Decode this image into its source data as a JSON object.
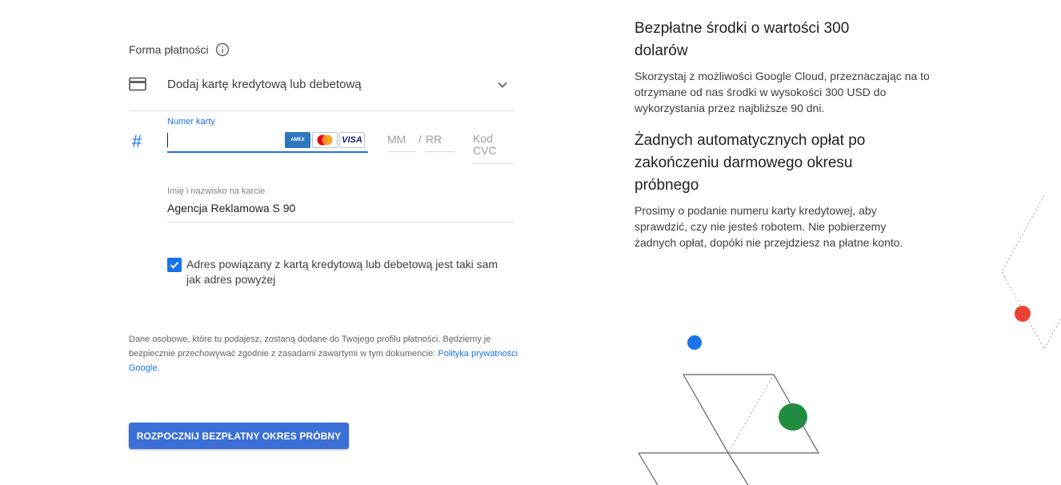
{
  "payment": {
    "section_title": "Forma płatności",
    "method_label": "Dodaj kartę kredytową lub debetową",
    "card_number_label": "Numer karty",
    "card_brands": [
      "AMEX",
      "MasterCard",
      "VISA"
    ],
    "month_placeholder": "MM",
    "year_separator": "/",
    "year_placeholder": "RR",
    "cvc_placeholder": "Kod CVC",
    "cardholder_label": "Imię i nazwisko na karcie",
    "cardholder_value": "Agencja Reklamowa S 90",
    "same_address_label": "Adres powiązany z kartą kredytową lub debetową jest taki sam jak adres powyżej",
    "same_address_checked": true,
    "privacy_text": "Dane osobowe, które tu podajesz, zostaną dodane do Twojego profilu płatności. Będziemy je bezpiecznie przechowywać zgodnie z zasadami zawartymi w tym dokumencie: ",
    "privacy_link": "Polityka prywatności Google",
    "privacy_end": ".",
    "start_button": "ROZPOCZNIJ BEZPŁATNY OKRES PRÓBNY"
  },
  "info": {
    "credits_title": "Bezpłatne środki o wartości 300 dolarów",
    "credits_text": "Skorzystaj z możliwości Google Cloud, przeznaczając na to otrzymane od nas środki w wysokości 300 USD do wykorzystania przez najbliższe 90 dni.",
    "no_charges_title": "Żadnych automatycznych opłat po zakończeniu darmowego okresu próbnego",
    "no_charges_text": "Prosimy o podanie numeru karty kredytowej, aby sprawdzić, czy nie jesteś robotem. Nie pobierzemy żadnych opłat, dopóki nie przejdziesz na płatne konto."
  },
  "colors": {
    "accent": "#1a73e8",
    "button": "#3b6fd6",
    "dot_blue": "#1a73e8",
    "dot_green": "#1e8e3e",
    "dot_red": "#ea4335"
  },
  "icons": {
    "info": "info-icon",
    "card": "credit-card-icon",
    "chevron": "chevron-down-icon",
    "hash": "hash-icon",
    "check": "check-icon"
  }
}
